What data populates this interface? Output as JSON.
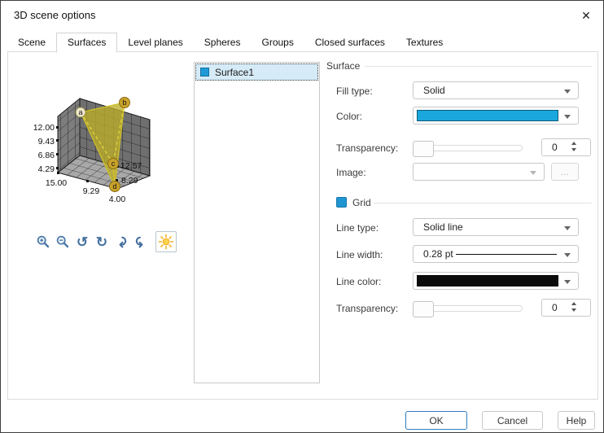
{
  "window": {
    "title": "3D scene options",
    "close_glyph": "✕"
  },
  "tabs": {
    "items": [
      "Scene",
      "Surfaces",
      "Level planes",
      "Spheres",
      "Groups",
      "Closed surfaces",
      "Textures"
    ],
    "active": "Surfaces"
  },
  "preview": {
    "z_axis_labels": [
      "12.00",
      "9.43",
      "6.86",
      "4.29"
    ],
    "x_axis_labels": [
      "15.00",
      "9.29",
      "4.00"
    ],
    "y_axis_labels": [
      "12.57",
      "8.29"
    ],
    "point_labels": [
      "a",
      "b",
      "c",
      "d"
    ],
    "surface_fill_color": "#bcae28",
    "toolbar": {
      "rotate_left_glyph": "↺",
      "rotate_right_glyph": "↻",
      "rotate_forward_glyph": "↷",
      "rotate_back_glyph": "↶"
    }
  },
  "surfaces_list": {
    "items": [
      {
        "label": "Surface1",
        "selected": true,
        "color": "#1f9bd7"
      }
    ]
  },
  "surface_group": {
    "title": "Surface",
    "fill_type_label": "Fill type:",
    "fill_type_value": "Solid",
    "color_label": "Color:",
    "color_value": "#19a7dd",
    "transparency_label": "Transparency:",
    "transparency_value": "0",
    "image_label": "Image:",
    "image_value": "",
    "browse_label": "..."
  },
  "grid_group": {
    "title": "Grid",
    "checkbox_color": "#1f96d2",
    "line_type_label": "Line type:",
    "line_type_value": "Solid line",
    "line_width_label": "Line width:",
    "line_width_value": "0.28 pt",
    "line_color_label": "Line color:",
    "line_color_value": "#0a0a0a",
    "transparency_label": "Transparency:",
    "transparency_value": "0"
  },
  "footer": {
    "ok_label": "OK",
    "cancel_label": "Cancel",
    "help_label": "Help"
  }
}
